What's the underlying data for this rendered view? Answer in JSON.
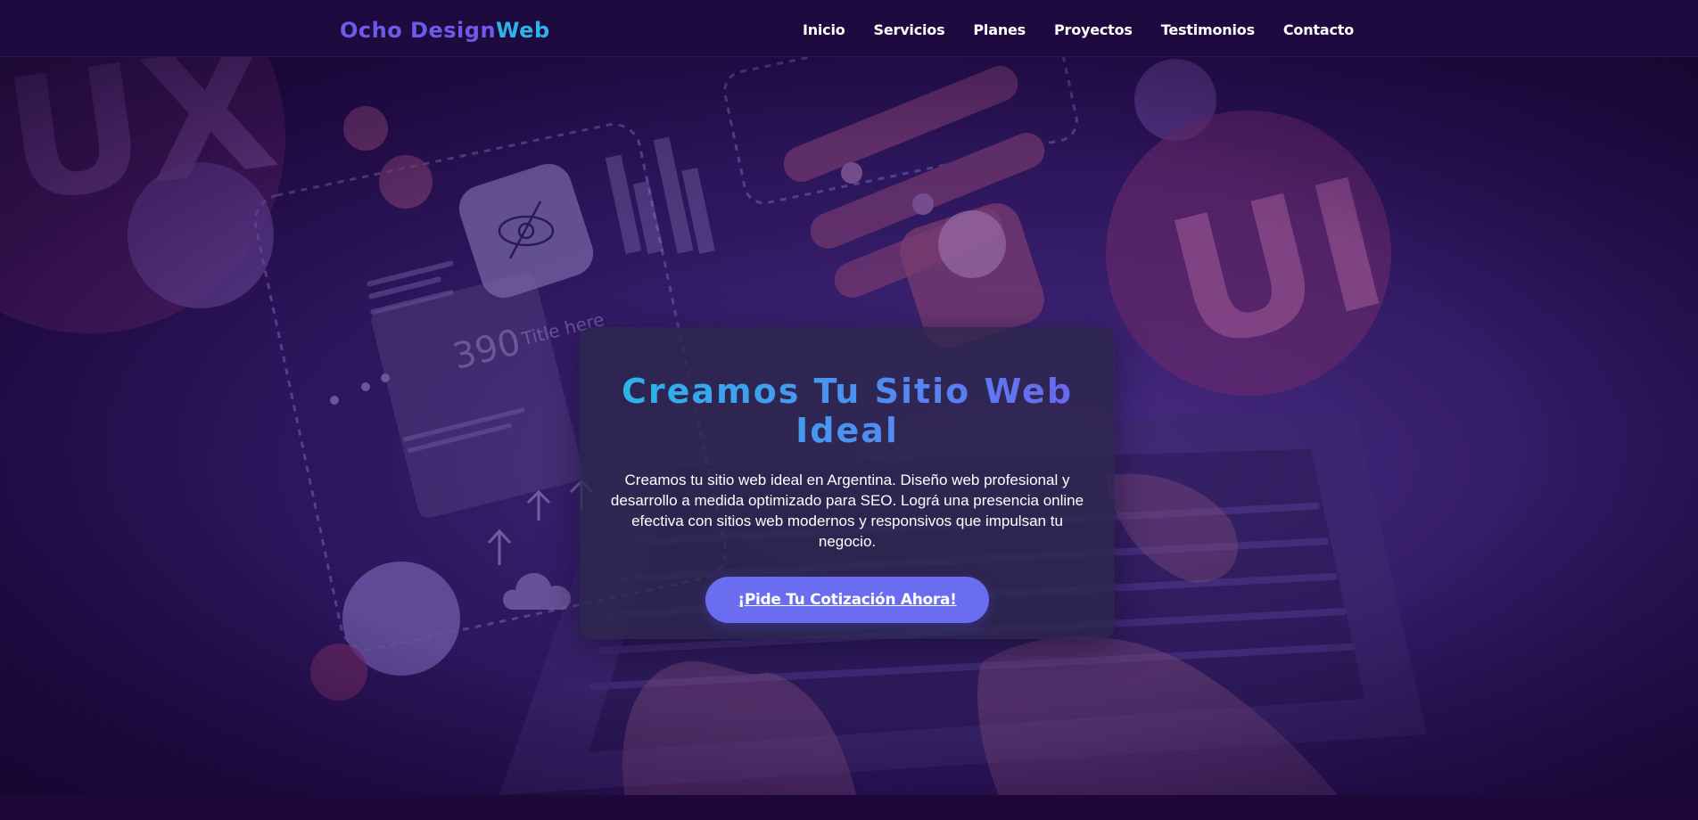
{
  "brand": {
    "name_part1": "Ocho Design",
    "name_part2": "Web"
  },
  "nav": {
    "items": [
      {
        "label": "Inicio"
      },
      {
        "label": "Servicios"
      },
      {
        "label": "Planes"
      },
      {
        "label": "Proyectos"
      },
      {
        "label": "Testimonios"
      },
      {
        "label": "Contacto"
      }
    ]
  },
  "hero": {
    "title": "Creamos Tu Sitio Web Ideal",
    "description": "Creamos tu sitio web ideal en Argentina. Diseño web profesional y desarrollo a medida optimizado para SEO. Lográ una presencia online efectiva con sitios web modernos y responsivos que impulsan tu negocio.",
    "cta_label": "¡Pide Tu Cotización Ahora!",
    "background_text": {
      "left": "UX",
      "right": "UI",
      "mock_number": "390",
      "mock_title": "Title here"
    }
  },
  "colors": {
    "nav_bg": "#1f0a40",
    "brand_primary": "#6d5be8",
    "brand_accent": "#2ab4e8",
    "cta_bg": "#6a6df0",
    "hero_title_gradient": [
      "#2bb5e8",
      "#6a67ee"
    ]
  }
}
